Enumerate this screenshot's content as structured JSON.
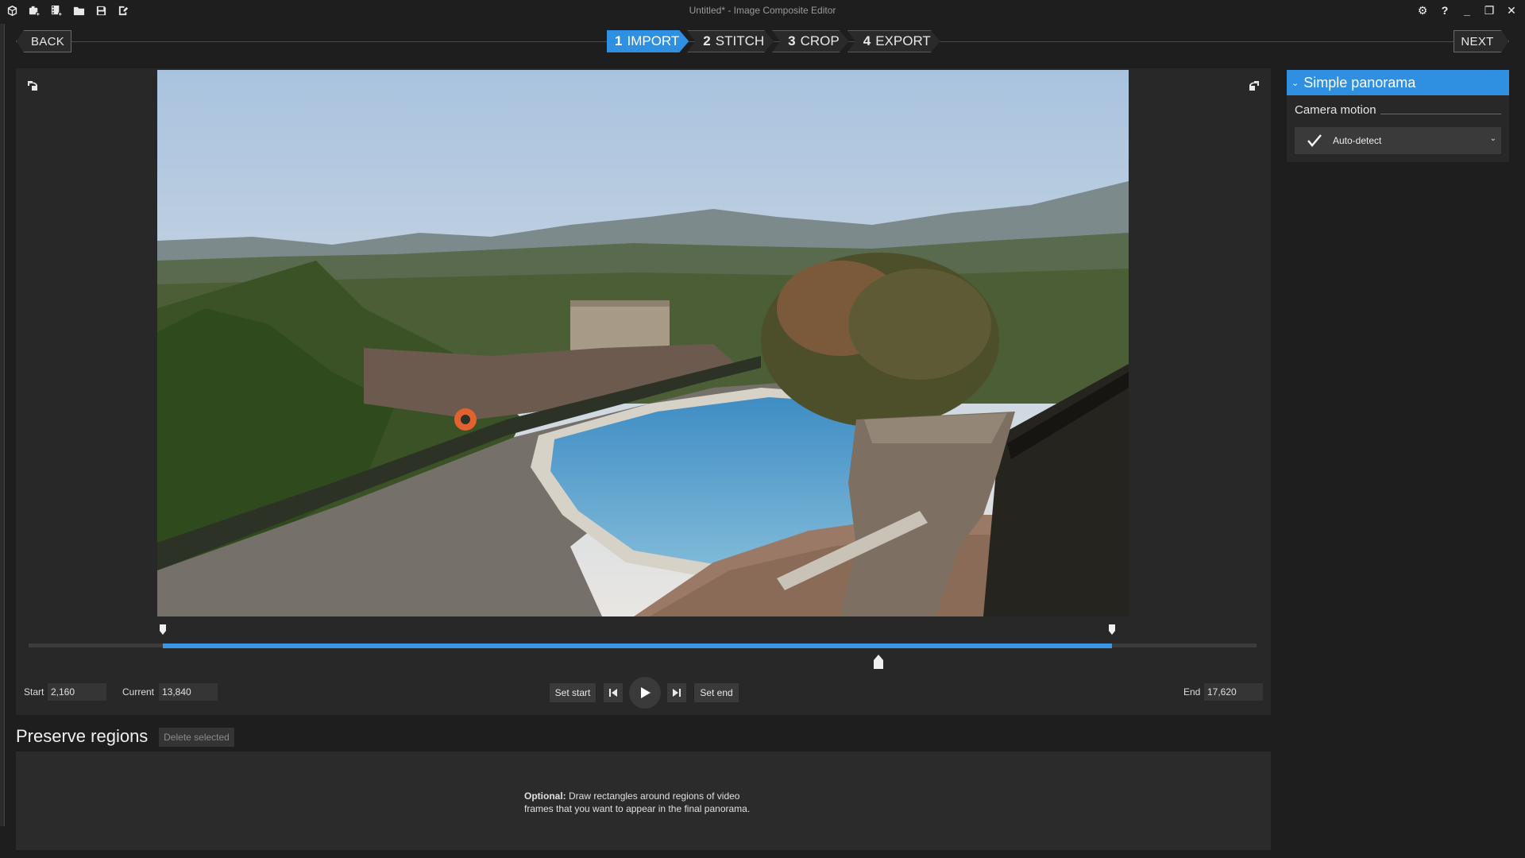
{
  "window": {
    "title": "Untitled* - Image Composite Editor",
    "quick_access_icons": [
      "app-icon",
      "new-panorama-icon",
      "new-video-panorama-icon",
      "open-folder-icon",
      "save-icon",
      "export-icon"
    ],
    "controls": [
      "settings-icon",
      "help-icon",
      "minimize-icon",
      "restore-icon",
      "close-icon"
    ]
  },
  "nav": {
    "back_label": "BACK",
    "next_label": "NEXT",
    "steps": [
      {
        "num": "1",
        "label": "IMPORT",
        "active": true
      },
      {
        "num": "2",
        "label": "STITCH",
        "active": false
      },
      {
        "num": "3",
        "label": "CROP",
        "active": false
      },
      {
        "num": "4",
        "label": "EXPORT",
        "active": false
      }
    ]
  },
  "timeline": {
    "start_label": "Start",
    "start_value": "2,160",
    "current_label": "Current",
    "current_value": "13,840",
    "end_label": "End",
    "end_value": "17,620",
    "set_start_label": "Set start",
    "set_end_label": "Set end",
    "selection_start_fraction": 0.109,
    "selection_end_fraction": 0.882,
    "playhead_fraction": 0.692
  },
  "settings_panel": {
    "section_title": "Simple panorama",
    "camera_motion_label": "Camera motion",
    "camera_motion_value": "Auto-detect"
  },
  "preserve_regions": {
    "title": "Preserve regions",
    "delete_label": "Delete selected",
    "hint_bold": "Optional:",
    "hint_text": " Draw rectangles around regions of video frames that you want to appear in the final panorama."
  },
  "colors": {
    "accent": "#2f8fe0",
    "background": "#1e1e1e",
    "panel": "#282828"
  }
}
